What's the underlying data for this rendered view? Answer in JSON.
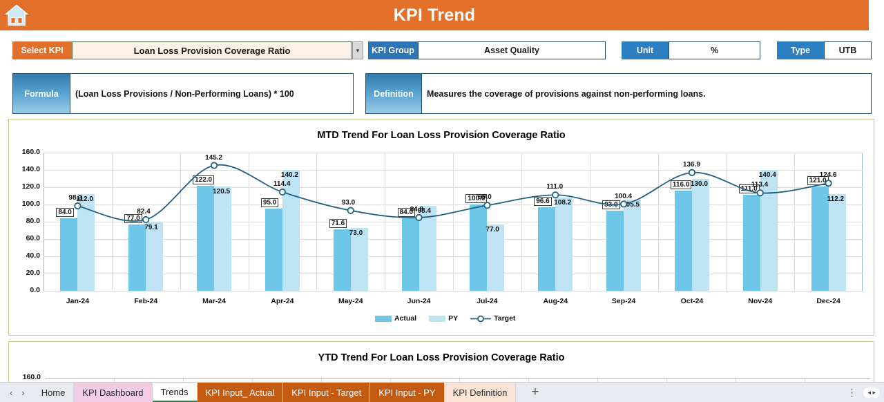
{
  "header": {
    "title": "KPI Trend",
    "home_icon": "home-icon",
    "bar_color": "#E3702A"
  },
  "selector_row": {
    "select_kpi_label": "Select KPI",
    "select_kpi_value": "Loan Loss Provision Coverage Ratio",
    "dropdown_icon": "chevron-down-icon",
    "kpi_group_label": "KPI Group",
    "kpi_group_value": "Asset Quality",
    "unit_label": "Unit",
    "unit_value": "%",
    "type_label": "Type",
    "type_value": "UTB"
  },
  "info_row": {
    "formula_label": "Formula",
    "formula_value": "(Loan Loss Provisions / Non-Performing Loans) * 100",
    "definition_label": "Definition",
    "definition_value": "Measures the coverage of provisions against non-performing loans."
  },
  "colors": {
    "accent_orange": "#E3702A",
    "actual_bar": "#6EC6E8",
    "py_bar": "#BDE3F5",
    "target_line": "#1F6080",
    "panel_border": "#BFD08A"
  },
  "mtd_chart_title": "MTD Trend For Loan Loss Provision Coverage Ratio",
  "ytd_chart_title": "YTD Trend For Loan Loss Provision Coverage Ratio",
  "ytd_first_ytick": "160.0",
  "legend": {
    "actual": "Actual",
    "py": "PY",
    "target": "Target"
  },
  "chart_data": {
    "type": "bar",
    "title": "MTD Trend For Loan Loss Provision Coverage Ratio",
    "xlabel": "",
    "ylabel": "",
    "ylim": [
      0,
      160
    ],
    "yticks": [
      "0.0",
      "20.0",
      "40.0",
      "60.0",
      "80.0",
      "100.0",
      "120.0",
      "140.0",
      "160.0"
    ],
    "grid": true,
    "legend_position": "bottom",
    "categories": [
      "Jan-24",
      "Feb-24",
      "Mar-24",
      "Apr-24",
      "May-24",
      "Jun-24",
      "Jul-24",
      "Aug-24",
      "Sep-24",
      "Oct-24",
      "Nov-24",
      "Dec-24"
    ],
    "series": [
      {
        "name": "Actual",
        "type": "bar",
        "color": "#6EC6E8",
        "values": [
          84.0,
          77.0,
          122.0,
          95.0,
          71.6,
          84.0,
          100.0,
          96.6,
          93.0,
          116.0,
          111.0,
          121.0
        ],
        "labels": [
          "84.0",
          "77.0",
          "122.0",
          "95.0",
          "71.6",
          "84.0",
          "100.0",
          "96.6",
          "93.0",
          "116.0",
          "111.0",
          "121.0"
        ]
      },
      {
        "name": "PY",
        "type": "bar",
        "color": "#BDE3F5",
        "values": [
          112.0,
          79.1,
          120.5,
          140.2,
          73.0,
          98.4,
          77.0,
          108.2,
          105.5,
          130.0,
          140.4,
          112.2
        ],
        "labels": [
          "112.0",
          "79.1",
          "120.5",
          "140.2",
          "73.0",
          "98.4",
          "77.0",
          "108.2",
          "105.5",
          "130.0",
          "140.4",
          "112.2"
        ]
      },
      {
        "name": "Target",
        "type": "line",
        "color": "#1F6080",
        "values": [
          98.3,
          82.4,
          145.2,
          114.4,
          93.0,
          84.8,
          99.0,
          111.0,
          100.4,
          136.9,
          113.4,
          124.6
        ],
        "labels": [
          "98.3",
          "82.4",
          "145.2",
          "114.4",
          "93.0",
          "84.8",
          "99.0",
          "111.0",
          "100.4",
          "136.9",
          "113.4",
          "124.6"
        ]
      }
    ]
  },
  "tabbar": {
    "prev_icon": "chevron-left-icon",
    "next_icon": "chevron-right-icon",
    "add_icon": "plus-icon",
    "more_icon": "kebab-menu-icon",
    "tabs": [
      {
        "label": "Home",
        "color": "transparent",
        "active": false
      },
      {
        "label": "KPI Dashboard",
        "color": "#F2CCE5",
        "active": false
      },
      {
        "label": "Trends",
        "color": "#ffffff",
        "active": true
      },
      {
        "label": "KPI Input_ Actual",
        "color": "#C55A11",
        "active": false
      },
      {
        "label": "KPI Input - Target",
        "color": "#C55A11",
        "active": false
      },
      {
        "label": "KPI Input - PY",
        "color": "#C55A11",
        "active": false
      },
      {
        "label": "KPI Definition",
        "color": "#FBE3D5",
        "active": false
      }
    ]
  }
}
